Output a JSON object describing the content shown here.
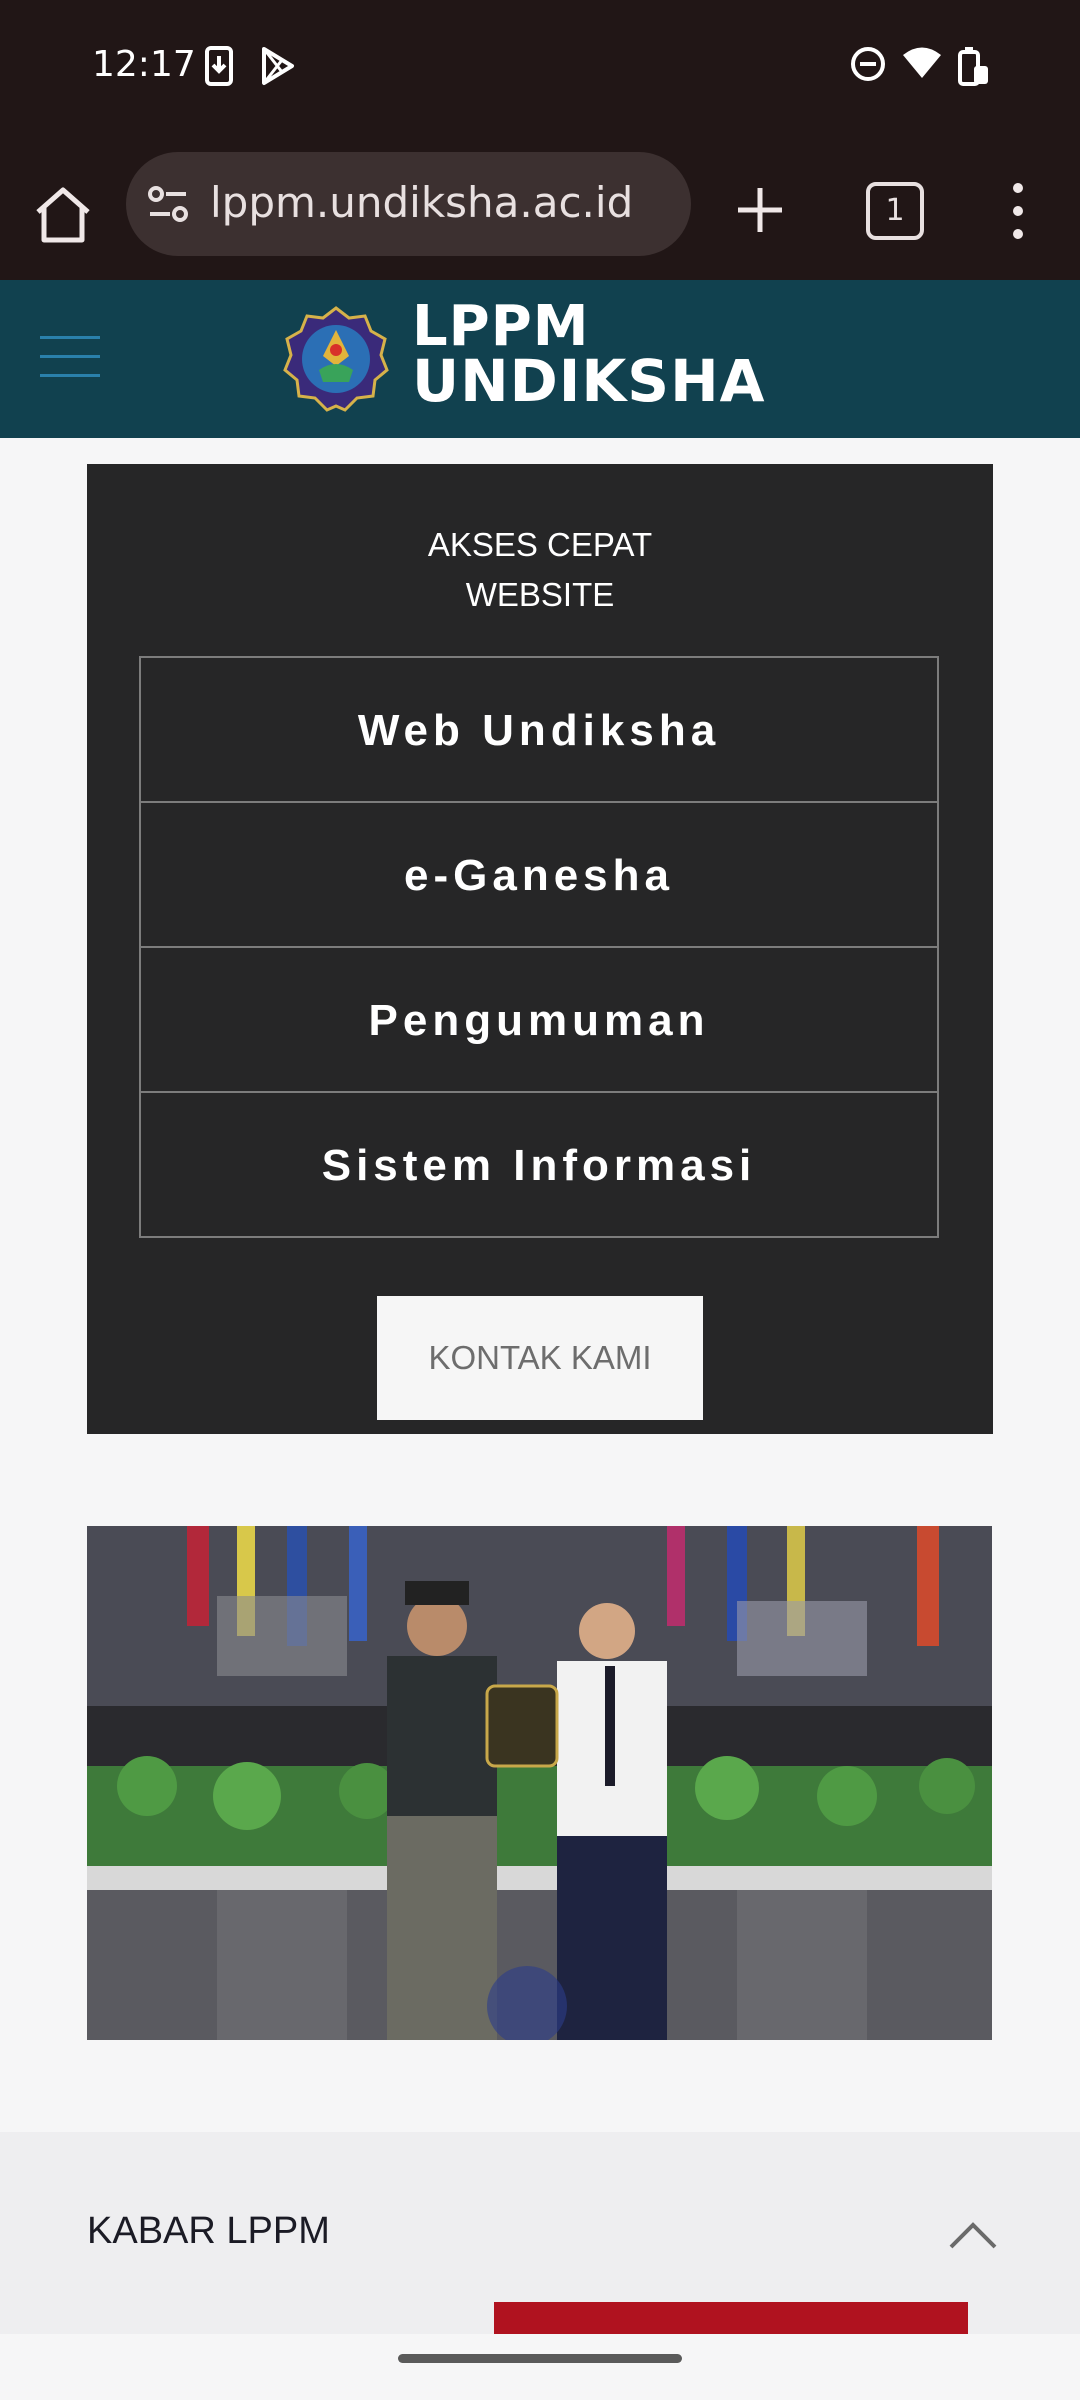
{
  "status_bar": {
    "time": "12:17"
  },
  "browser": {
    "url": "lppm.undiksha.ac.id",
    "tab_count": "1"
  },
  "site_header": {
    "logo_line1": "LPPM",
    "logo_line2": "UNDIKSHA"
  },
  "quick_access": {
    "title_line1": "AKSES CEPAT",
    "title_line2": "WEBSITE",
    "items": [
      {
        "label": "Web Undiksha"
      },
      {
        "label": "e-Ganesha"
      },
      {
        "label": "Pengumuman"
      },
      {
        "label": "Sistem Informasi"
      }
    ],
    "contact_label": "KONTAK KAMI"
  },
  "news": {
    "title": "KABAR LPPM"
  },
  "colors": {
    "header_bg": "#11414f",
    "panel_bg": "#262627",
    "accent_red": "#b0121f"
  }
}
